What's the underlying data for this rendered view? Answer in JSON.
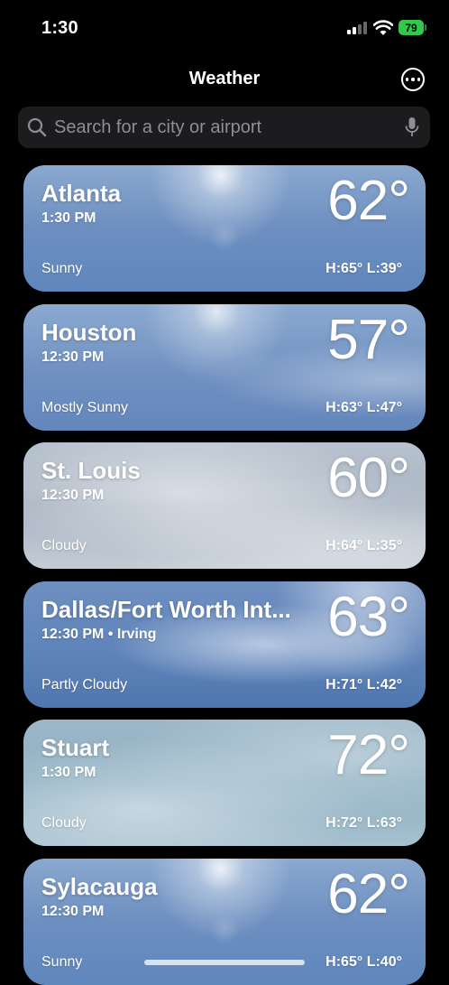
{
  "status_bar": {
    "time": "1:30",
    "battery": "79"
  },
  "header": {
    "title": "Weather"
  },
  "search": {
    "placeholder": "Search for a city or airport"
  },
  "cities": [
    {
      "name": "Atlanta",
      "time": "1:30 PM",
      "temp": "62°",
      "condition": "Sunny",
      "hilo": "H:65°  L:39°"
    },
    {
      "name": "Houston",
      "time": "12:30 PM",
      "temp": "57°",
      "condition": "Mostly Sunny",
      "hilo": "H:63°  L:47°"
    },
    {
      "name": "St. Louis",
      "time": "12:30 PM",
      "temp": "60°",
      "condition": "Cloudy",
      "hilo": "H:64°  L:35°"
    },
    {
      "name": "Dallas/Fort Worth Int...",
      "time": "12:30 PM • Irving",
      "temp": "63°",
      "condition": "Partly Cloudy",
      "hilo": "H:71°  L:42°"
    },
    {
      "name": "Stuart",
      "time": "1:30 PM",
      "temp": "72°",
      "condition": "Cloudy",
      "hilo": "H:72°  L:63°"
    },
    {
      "name": "Sylacauga",
      "time": "12:30 PM",
      "temp": "62°",
      "condition": "Sunny",
      "hilo": "H:65°  L:40°"
    }
  ],
  "colors": {
    "background": "#000000",
    "search_bg": "#1c1c1e",
    "placeholder": "#8e8e93",
    "battery": "#32c84a"
  },
  "icons": [
    "signal-icon",
    "wifi-icon",
    "battery-icon",
    "more-icon",
    "search-icon",
    "mic-icon"
  ]
}
